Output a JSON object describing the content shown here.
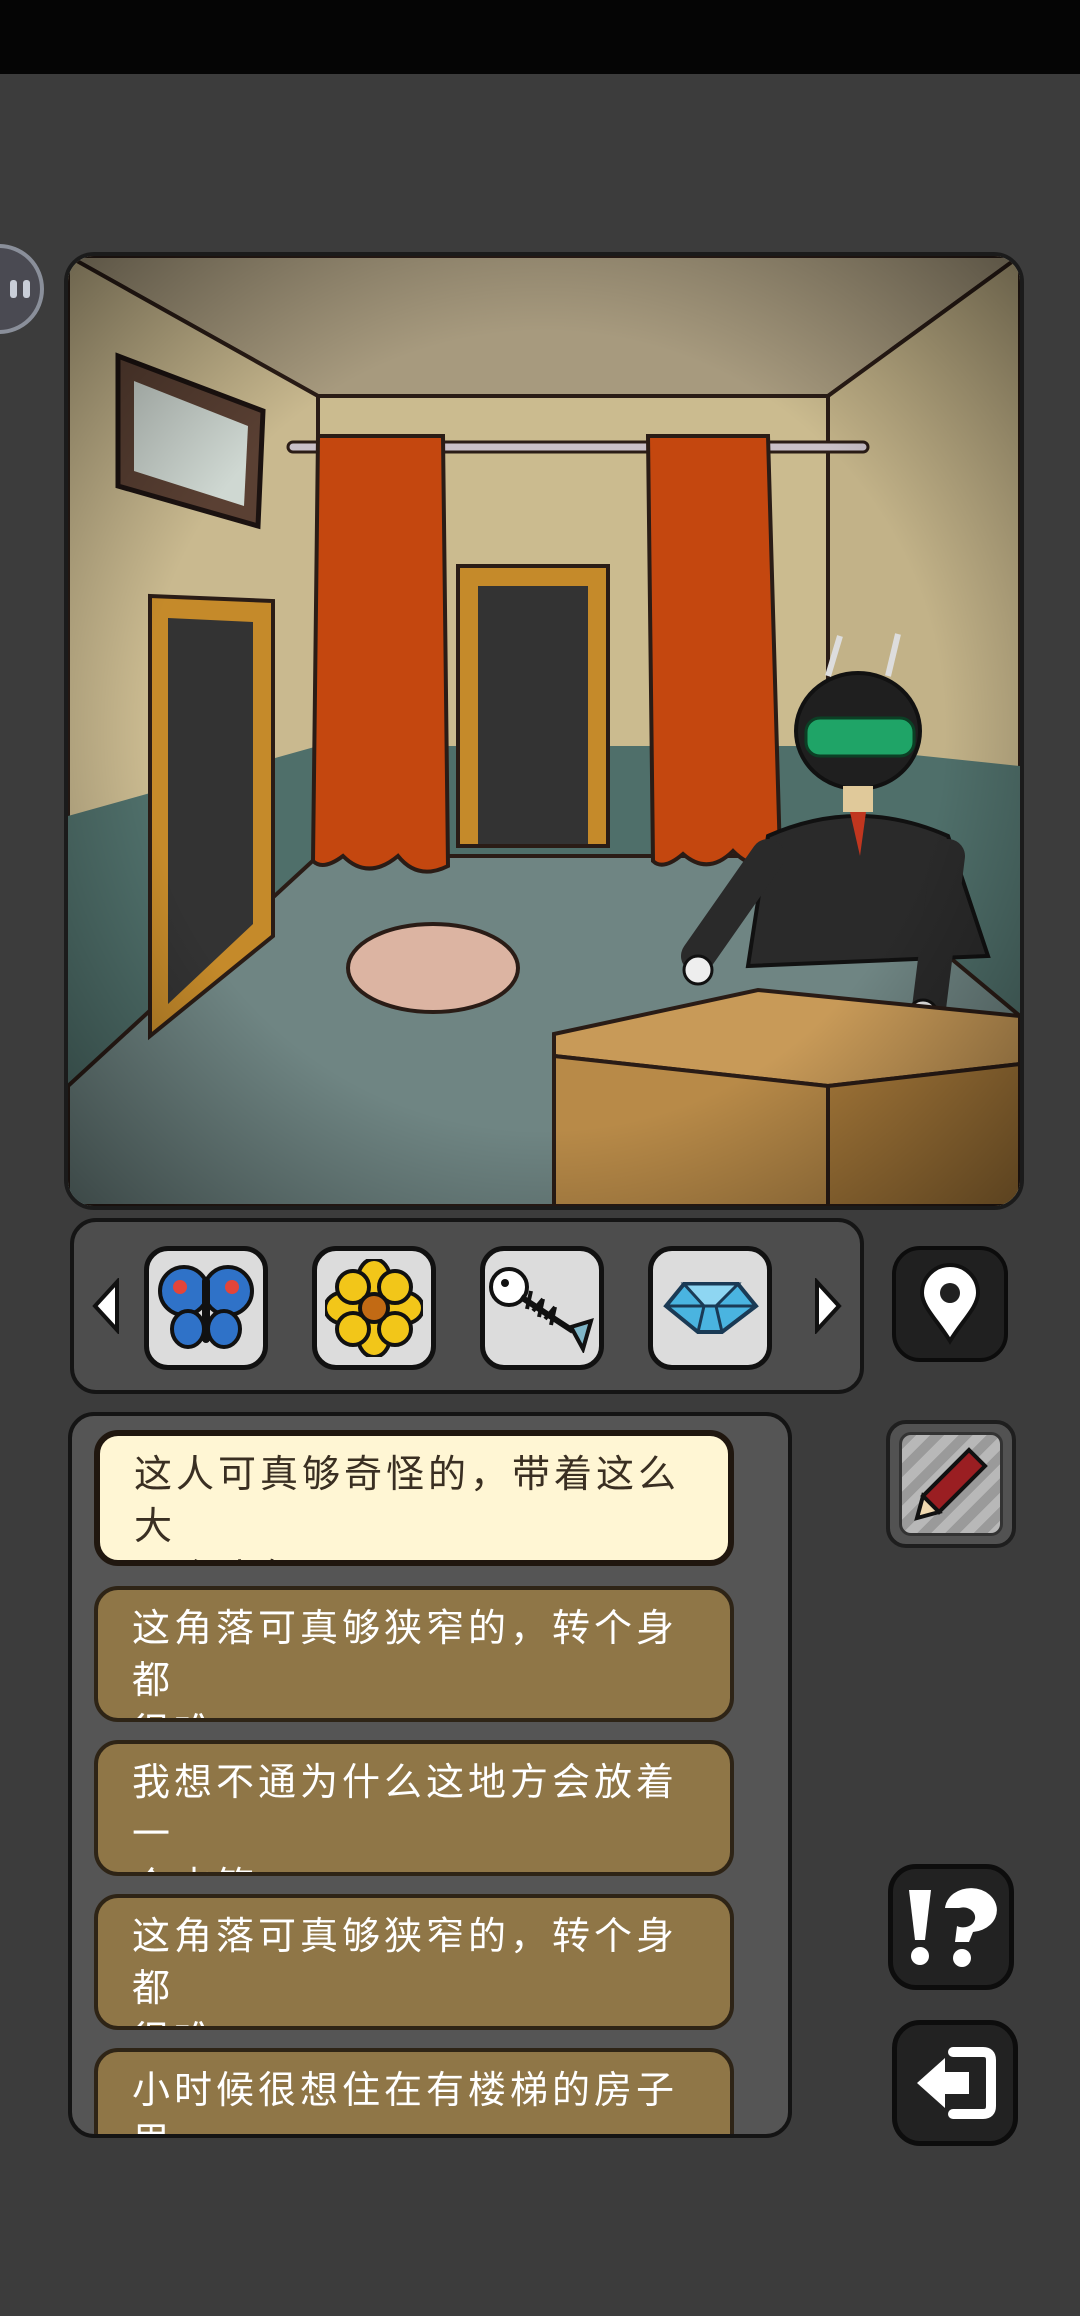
{
  "scene": {
    "description_icons": [
      "framed-picture",
      "curtain",
      "doorway",
      "robot-helmet-man",
      "desk",
      "round-rug"
    ]
  },
  "inventory": {
    "items": [
      {
        "name": "butterfly",
        "icon": "butterfly-icon"
      },
      {
        "name": "flower",
        "icon": "flower-icon"
      },
      {
        "name": "fish-bone",
        "icon": "fish-bone-icon"
      },
      {
        "name": "crystal",
        "icon": "crystal-icon"
      }
    ]
  },
  "dialogue": {
    "options": [
      {
        "text": "这人可真够奇怪的，带着这么大\n一个头盔。",
        "selected": true
      },
      {
        "text": "这角落可真够狭窄的，转个身都\n很难。",
        "selected": false
      },
      {
        "text": "我想不通为什么这地方会放着一\n个皮箱。",
        "selected": false
      },
      {
        "text": "这角落可真够狭窄的，转个身都\n很难。",
        "selected": false
      },
      {
        "text": "小时候很想住在有楼梯的房子里",
        "selected": false
      }
    ]
  },
  "colors": {
    "background": "#3c3c3c",
    "option_bg": "#8f7647",
    "option_selected_bg": "#fff6d4",
    "curtain": "#c4470f",
    "wall": "#c9b890",
    "floor": "#6f8583"
  }
}
